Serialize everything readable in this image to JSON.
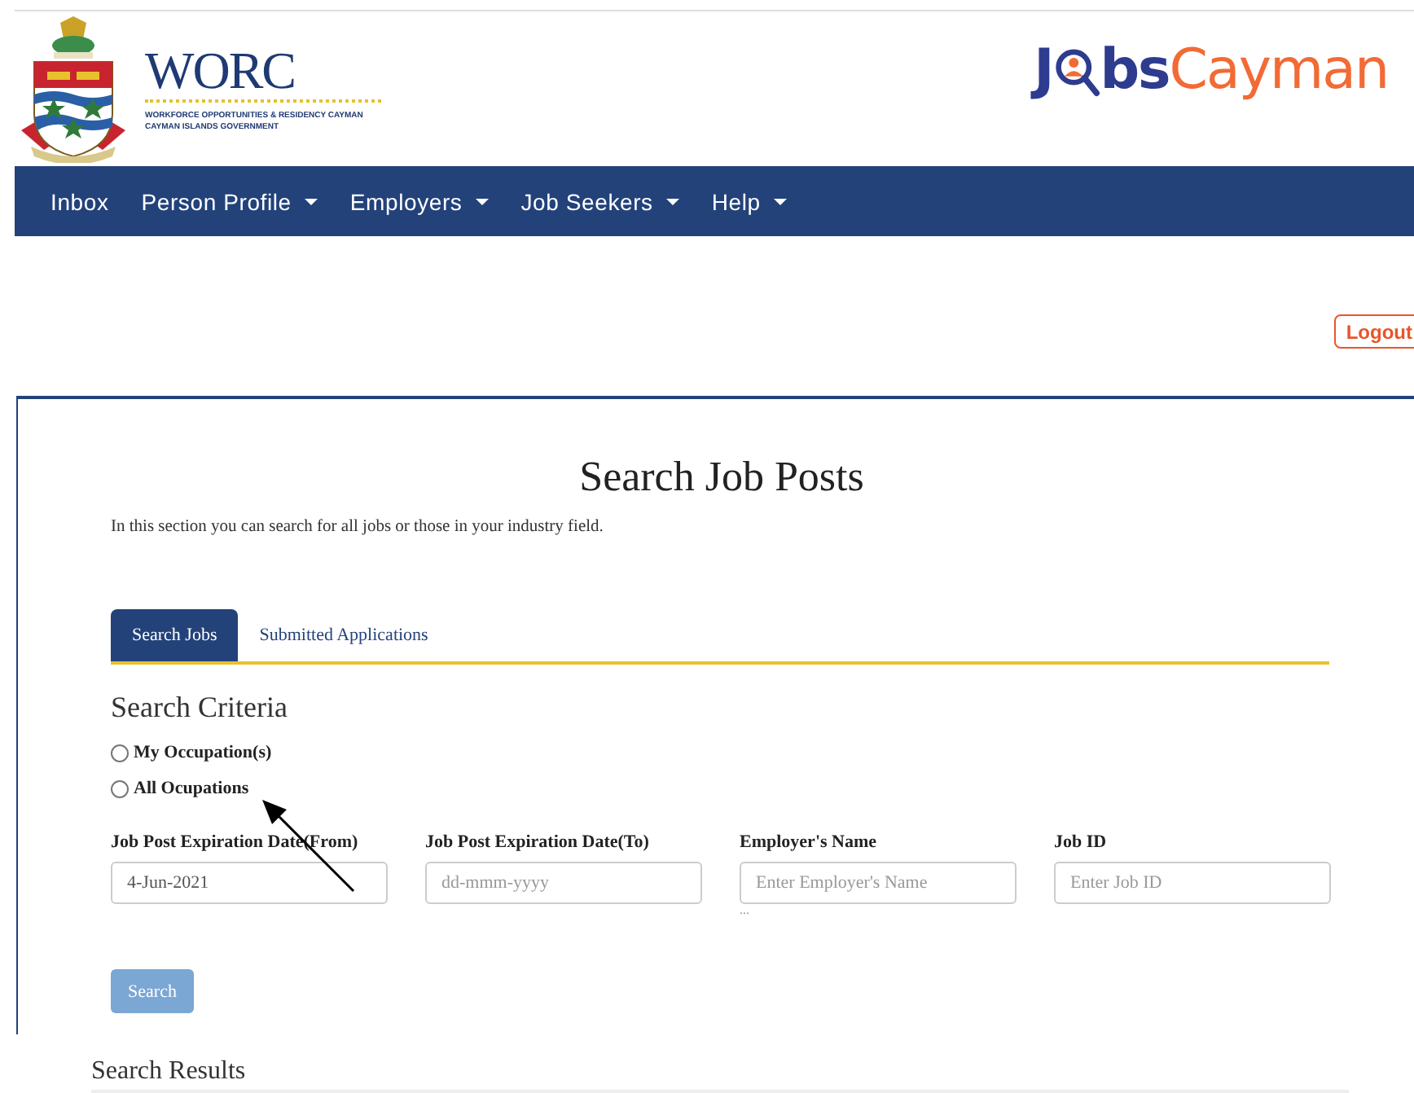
{
  "header": {
    "worc_logo": {
      "name": "WORC",
      "line1": "WORKFORCE OPPORTUNITIES & RESIDENCY CAYMAN",
      "line2": "CAYMAN ISLANDS GOVERNMENT"
    },
    "jobs_logo": {
      "first": "J",
      "rest": "bs",
      "accent": "Cayman"
    }
  },
  "nav": [
    {
      "label": "Inbox",
      "dropdown": false
    },
    {
      "label": "Person Profile",
      "dropdown": true
    },
    {
      "label": "Employers",
      "dropdown": true
    },
    {
      "label": "Job Seekers",
      "dropdown": true
    },
    {
      "label": "Help",
      "dropdown": true
    }
  ],
  "logout": "Logout",
  "page": {
    "title": "Search Job Posts",
    "description": "In this section you can search for all jobs or those in your industry field."
  },
  "tabs": [
    {
      "label": "Search Jobs",
      "selected": true
    },
    {
      "label": "Submitted Applications",
      "selected": false
    }
  ],
  "criteria": {
    "heading": "Search Criteria",
    "options": [
      {
        "label": "My Occupation(s)",
        "selected": false
      },
      {
        "label": "All Ocupations",
        "selected": false
      }
    ],
    "fields": [
      {
        "label": "Job Post Expiration Date(From)",
        "value": "4-Jun-2021"
      },
      {
        "label": "Job Post Expiration Date(To)",
        "placeholder": "dd-mmm-yyyy"
      },
      {
        "label": "Employer's Name",
        "placeholder": "Enter Employer's Name",
        "note": "..."
      },
      {
        "label": "Job ID",
        "placeholder": "Enter Job ID"
      }
    ],
    "button": "Search"
  },
  "results": {
    "heading": "Search Results"
  }
}
